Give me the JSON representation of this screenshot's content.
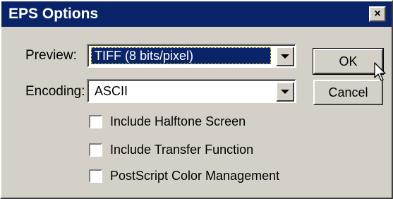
{
  "window": {
    "title": "EPS Options",
    "close_glyph": "×"
  },
  "preview": {
    "label": "Preview:",
    "value": "TIFF  (8 bits/pixel)"
  },
  "encoding": {
    "label": "Encoding:",
    "value": "ASCII"
  },
  "buttons": {
    "ok": "OK",
    "cancel": "Cancel"
  },
  "options": [
    {
      "label": "Include Halftone Screen",
      "checked": false
    },
    {
      "label": "Include Transfer Function",
      "checked": false
    },
    {
      "label": "PostScript Color Management",
      "checked": false
    }
  ],
  "colors": {
    "titlebar": "#0a246a",
    "face": "#d4d0c8",
    "selection": "#0a246a"
  },
  "icons": {
    "combo_arrow": "chevron-down-icon",
    "pointer": "mouse-pointer-icon",
    "close": "close-icon"
  }
}
